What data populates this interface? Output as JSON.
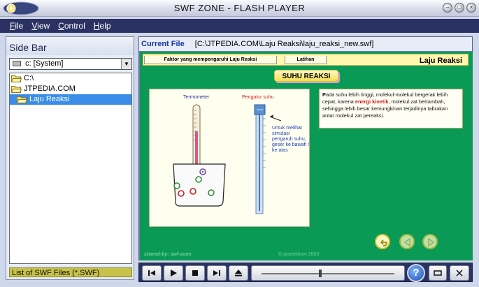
{
  "window": {
    "title": "SWF ZONE - FLASH PLAYER"
  },
  "menu": [
    {
      "label": "File",
      "underline": "F",
      "rest": "ile"
    },
    {
      "label": "View",
      "underline": "V",
      "rest": "iew"
    },
    {
      "label": "Control",
      "underline": "C",
      "rest": "ontrol"
    },
    {
      "label": "Help",
      "underline": "H",
      "rest": "elp"
    }
  ],
  "sidebar": {
    "title": "Side Bar",
    "drive": "c: [System]",
    "tree": [
      {
        "label": "C:\\"
      },
      {
        "label": "JTPEDIA.COM"
      },
      {
        "label": "Laju Reaksi",
        "selected": true
      }
    ],
    "list_caption": "List of SWF Files (*.SWF)"
  },
  "current_file": {
    "label": "Current File",
    "path": "[C:\\JTPEDIA.COM\\Laju Reaksi\\laju_reaksi_new.swf]"
  },
  "swf": {
    "tabs": [
      "Faktor yang mempengaruhi Laju Reaksi",
      "Latihan"
    ],
    "section_title": "Laju Reaksi",
    "heading": "SUHU REAKSI",
    "label_termometer": "Termometer",
    "label_pengatur": "Pengatur suhu",
    "hint": "Untuk melihat simulasi pengaruh suhu, geser ke bawah / ke atas",
    "info_p1": "P",
    "info_p2": "ada suhu lebih tinggi, molekul-molekul bergerak lebih cepat, karena ",
    "info_red": "energi kinetik",
    "info_p3": ", molekul zat bertambah, sehingga lebih besar kemungkinan terjadinya tabrakan antar molekul zat pereaksi.",
    "shared_by": "shared-by: swf-zone",
    "copyright": "© pustekkom 2003"
  },
  "colors": {
    "menubar": "#2a3263",
    "stage": "#0b9a55",
    "accent_red": "#d01818"
  },
  "player": {
    "buttons": [
      "prev-icon",
      "play-icon",
      "stop-icon",
      "next-icon",
      "eject-icon"
    ],
    "help": "?"
  }
}
